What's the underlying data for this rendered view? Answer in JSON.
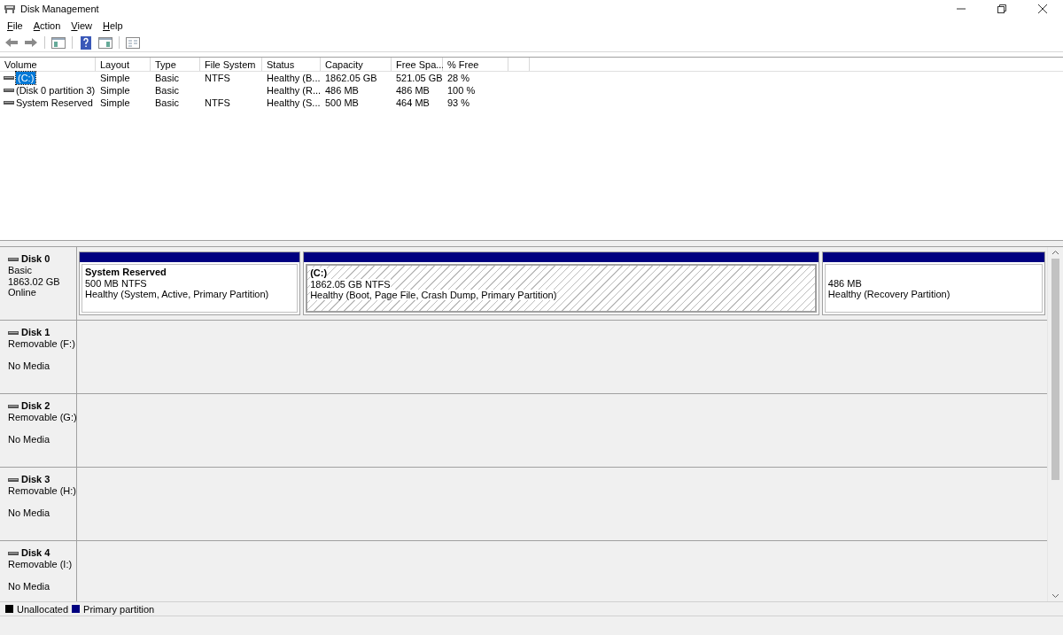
{
  "window": {
    "title": "Disk Management"
  },
  "menu": [
    "File",
    "Action",
    "View",
    "Help"
  ],
  "table": {
    "columns": [
      "Volume",
      "Layout",
      "Type",
      "File System",
      "Status",
      "Capacity",
      "Free Spa...",
      "% Free"
    ],
    "rows": [
      {
        "selected": true,
        "cells": [
          "(C:)",
          "Simple",
          "Basic",
          "NTFS",
          "Healthy (B...",
          "1862.05 GB",
          "521.05 GB",
          "28 %"
        ]
      },
      {
        "selected": false,
        "cells": [
          "(Disk 0 partition 3)",
          "Simple",
          "Basic",
          "",
          "Healthy (R...",
          "486 MB",
          "486 MB",
          "100 %"
        ]
      },
      {
        "selected": false,
        "cells": [
          "System Reserved",
          "Simple",
          "Basic",
          "NTFS",
          "Healthy (S...",
          "500 MB",
          "464 MB",
          "93 %"
        ]
      }
    ]
  },
  "disks": [
    {
      "name": "Disk 0",
      "lines": [
        "Basic",
        "1863.02 GB",
        "Online"
      ],
      "partitions": [
        {
          "name": "System Reserved",
          "size": "500 MB NTFS",
          "status": "Healthy (System, Active, Primary Partition)",
          "selected": false
        },
        {
          "name": "(C:)",
          "size": "1862.05 GB NTFS",
          "status": "Healthy (Boot, Page File, Crash Dump, Primary Partition)",
          "selected": true
        },
        {
          "size": "486 MB",
          "status": "Healthy (Recovery Partition)",
          "selected": false
        }
      ]
    },
    {
      "name": "Disk 1",
      "lines": [
        "Removable (F:)"
      ],
      "media": "No Media"
    },
    {
      "name": "Disk 2",
      "lines": [
        "Removable (G:)"
      ],
      "media": "No Media"
    },
    {
      "name": "Disk 3",
      "lines": [
        "Removable (H:)"
      ],
      "media": "No Media"
    },
    {
      "name": "Disk 4",
      "lines": [
        "Removable (I:)"
      ],
      "media": "No Media"
    }
  ],
  "legend": [
    {
      "label": "Unallocated",
      "color": "#000000"
    },
    {
      "label": "Primary partition",
      "color": "#000080"
    }
  ]
}
